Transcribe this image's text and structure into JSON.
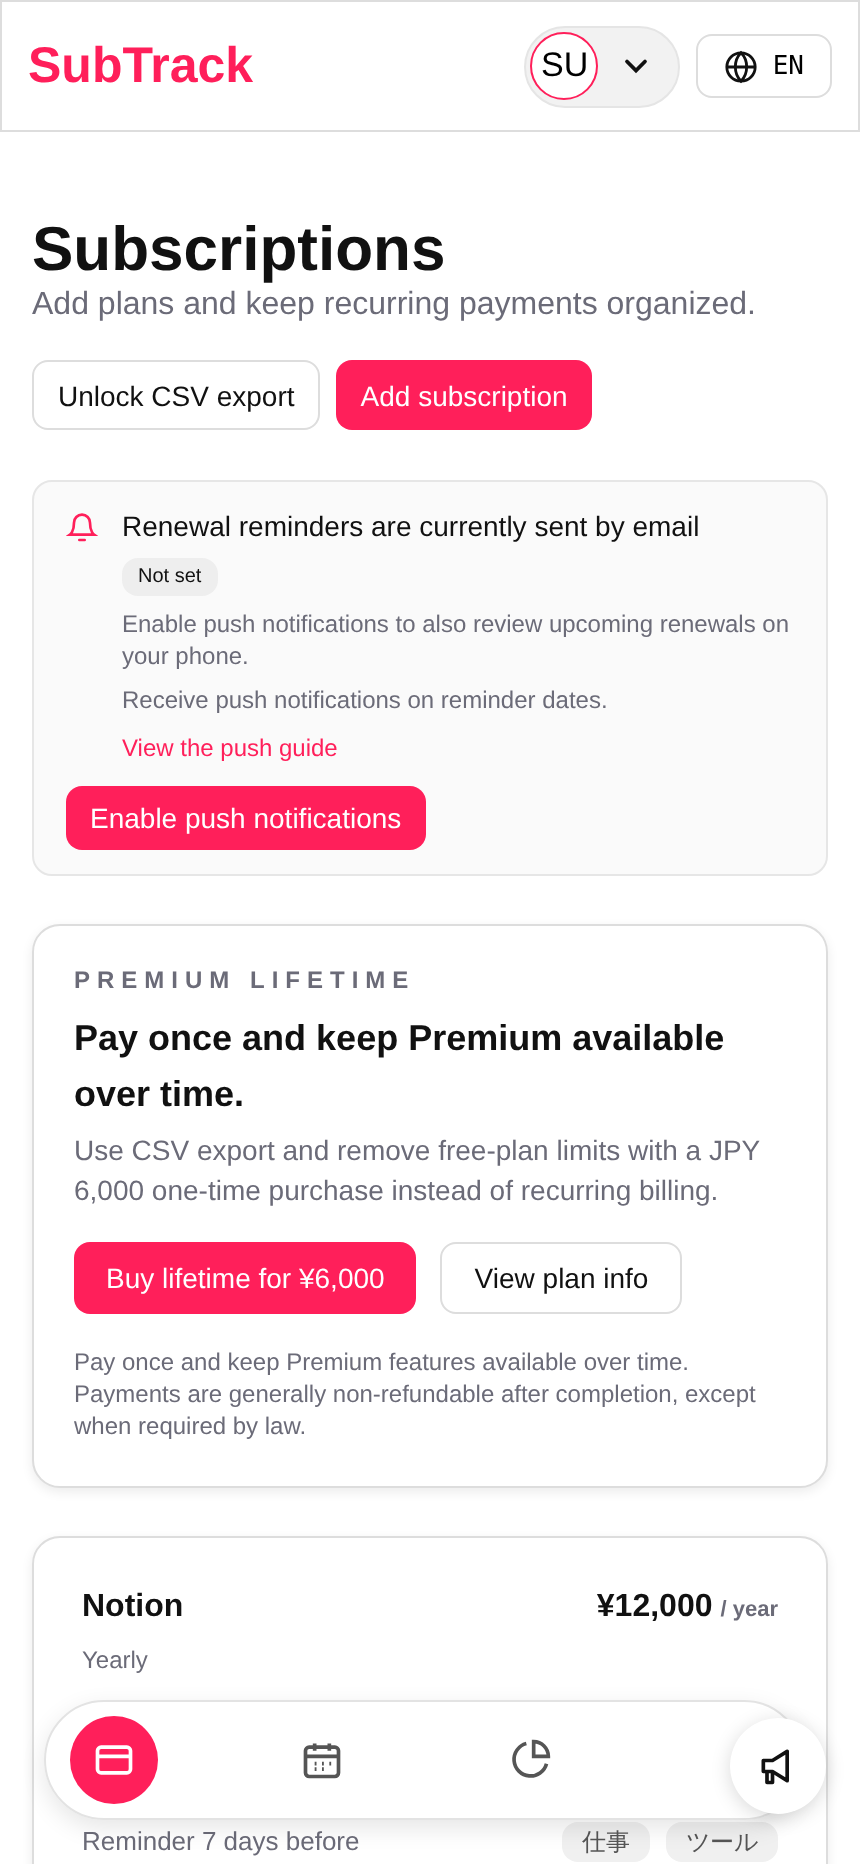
{
  "header": {
    "logo": "SubTrack",
    "account": {
      "initials": "SU"
    },
    "language": "EN"
  },
  "page": {
    "title": "Subscriptions",
    "subtitle": "Add plans and keep recurring payments organized.",
    "buttons": [
      {
        "label": "Unlock CSV export",
        "kind": "secondary"
      },
      {
        "label": "Add subscription",
        "kind": "primary"
      }
    ]
  },
  "reminder_notice": {
    "title": "Renewal reminders are currently sent by email",
    "status": "Not set",
    "lines": [
      "Enable push notifications to also review upcoming renewals on your phone.",
      "Receive push notifications on reminder dates."
    ],
    "link": "View the push guide",
    "button": "Enable push notifications"
  },
  "premium": {
    "eyebrow": "PREMIUM LIFETIME",
    "title": "Pay once and keep Premium available over time.",
    "description": "Use CSV export and remove free-plan limits with a JPY 6,000 one-time purchase instead of recurring billing.",
    "buttons": [
      {
        "label": "Buy lifetime for ¥6,000",
        "kind": "primary"
      },
      {
        "label": "View plan info",
        "kind": "secondary"
      }
    ],
    "note": "Pay once and keep Premium features available over time. Payments are generally non-refundable after completion, except when required by law."
  },
  "subscriptions": [
    {
      "name": "Notion",
      "price": "¥12,000",
      "period": "/ year",
      "cycle": "Yearly",
      "reminder": "Reminder 7 days before",
      "tags": [
        "仕事",
        "ツール"
      ]
    }
  ],
  "bottom_nav": {
    "items": [
      {
        "kind": "card",
        "selected": true
      },
      {
        "kind": "calendar",
        "selected": false
      },
      {
        "kind": "chart",
        "selected": false
      }
    ]
  }
}
